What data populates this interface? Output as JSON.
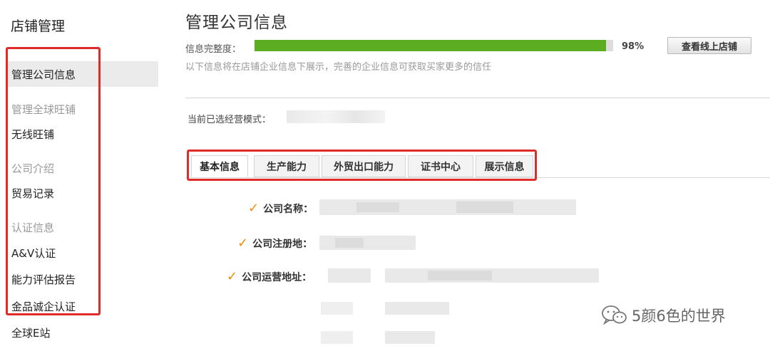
{
  "sidebar": {
    "title": "店铺管理",
    "items": [
      {
        "label": "管理公司信息",
        "kind": "active"
      },
      {
        "label": "管理全球旺铺",
        "kind": "group"
      },
      {
        "label": "无线旺铺",
        "kind": "item"
      },
      {
        "label": "公司介绍",
        "kind": "group"
      },
      {
        "label": "贸易记录",
        "kind": "item"
      },
      {
        "label": "认证信息",
        "kind": "group"
      },
      {
        "label": "A&V认证",
        "kind": "item"
      },
      {
        "label": "能力评估报告",
        "kind": "item"
      },
      {
        "label": "金品诚企认证",
        "kind": "item"
      },
      {
        "label": "全球E站",
        "kind": "item"
      }
    ]
  },
  "main": {
    "title": "管理公司信息",
    "completeness": {
      "label": "信息完整度：",
      "percent": 98,
      "percent_text": "98%"
    },
    "view_store_button": "查看线上店铺",
    "notice": "以下信息将在店铺企业信息下展示，完善的企业信息可获取买家更多的信任",
    "mode_label": "当前已选经营模式："
  },
  "tabs": [
    {
      "label": "基本信息",
      "active": true
    },
    {
      "label": "生产能力",
      "active": false
    },
    {
      "label": "外贸出口能力",
      "active": false
    },
    {
      "label": "证书中心",
      "active": false
    },
    {
      "label": "展示信息",
      "active": false
    }
  ],
  "form": {
    "fields": [
      {
        "label": "公司名称："
      },
      {
        "label": "公司注册地："
      },
      {
        "label": "公司运营地址："
      }
    ]
  },
  "watermark": {
    "text": "5颜6色的世界",
    "icon": "wechat-icon"
  },
  "colors": {
    "progress": "#5cad22",
    "highlight_box": "#e02b2b",
    "check": "#f08c00"
  }
}
